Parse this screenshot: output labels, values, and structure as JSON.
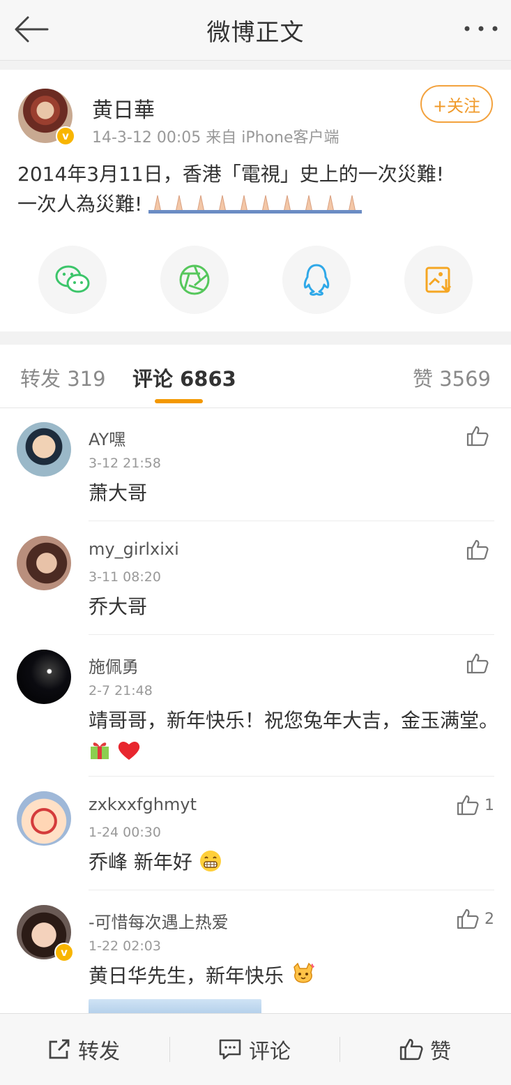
{
  "header": {
    "title": "微博正文"
  },
  "post": {
    "author": "黄日華",
    "meta": "14-3-12 00:05  来自 iPhone客户端",
    "follow_label": "+关注",
    "content_line1": "2014年3月11日，香港「電視」史上的一次災難!",
    "content_line2": "一次人為災難!"
  },
  "tabs": {
    "repost_label": "转发",
    "repost_count": "319",
    "comment_label": "评论",
    "comment_count": "6863",
    "like_label": "赞",
    "like_count": "3569"
  },
  "comments": [
    {
      "name": "AY嘿",
      "time": "3-12 21:58",
      "text": "萧大哥",
      "likes": ""
    },
    {
      "name": "my_girlxixi",
      "time": "3-11 08:20",
      "text": "乔大哥",
      "likes": ""
    },
    {
      "name": "施佩勇",
      "time": "2-7 21:48",
      "text": "靖哥哥，新年快乐！祝您兔年大吉，金玉满堂。",
      "likes": ""
    },
    {
      "name": "zxkxxfghmyt",
      "time": "1-24 00:30",
      "text": "乔峰 新年好",
      "likes": "1"
    },
    {
      "name": "-可惜每次遇上热爱",
      "time": "1-22 02:03",
      "text": "黄日华先生，新年快乐",
      "likes": "2"
    }
  ],
  "bottom": {
    "repost": "转发",
    "comment": "评论",
    "like": "赞"
  },
  "colors": {
    "accent": "#f39800",
    "follow": "#f3a23e",
    "verified": "#f8b500"
  }
}
